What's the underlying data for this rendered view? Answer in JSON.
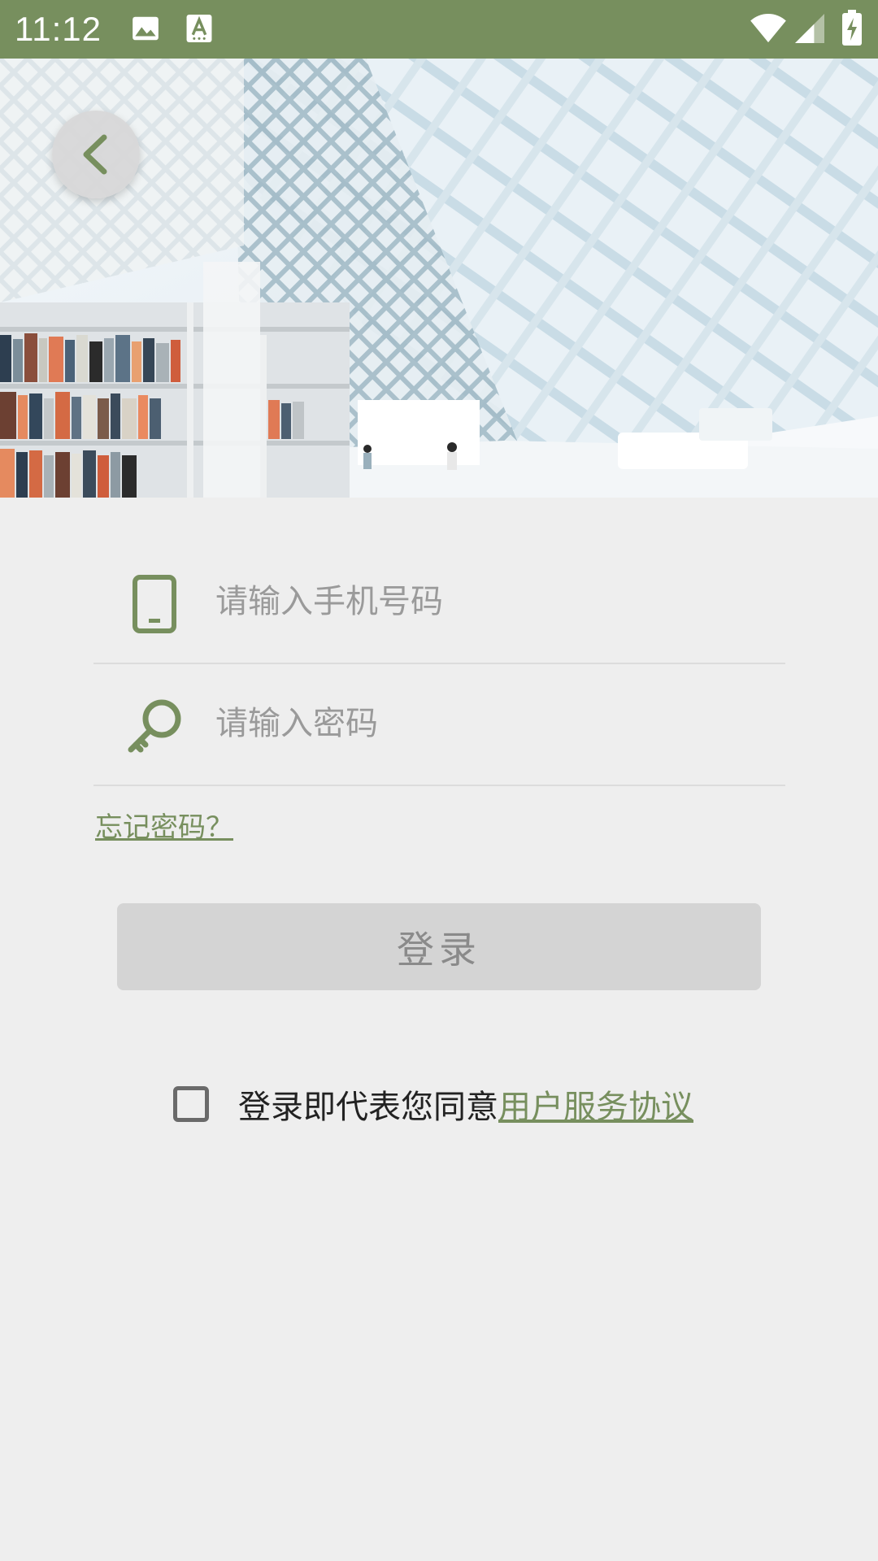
{
  "status_bar": {
    "time": "11:12",
    "background_color": "#778f5e",
    "left_icons": [
      "image-icon",
      "font-a-icon"
    ],
    "right_icons": [
      "wifi-icon",
      "cellular-signal-icon",
      "battery-charging-icon"
    ]
  },
  "hero": {
    "image_description_icon": "library-photo",
    "back_icon": "chevron-left-icon"
  },
  "form": {
    "phone": {
      "icon": "phone-icon",
      "placeholder": "请输入手机号码",
      "value": ""
    },
    "password": {
      "icon": "key-icon",
      "placeholder": "请输入密码",
      "value": ""
    },
    "forgot_password": "忘记密码？",
    "login_label": "登录"
  },
  "agreement": {
    "checked": false,
    "text": "登录即代表您同意",
    "link": "用户服务协议"
  },
  "colors": {
    "accent": "#778f5e",
    "background": "#eeeeee",
    "button_disabled": "#d4d4d4"
  }
}
